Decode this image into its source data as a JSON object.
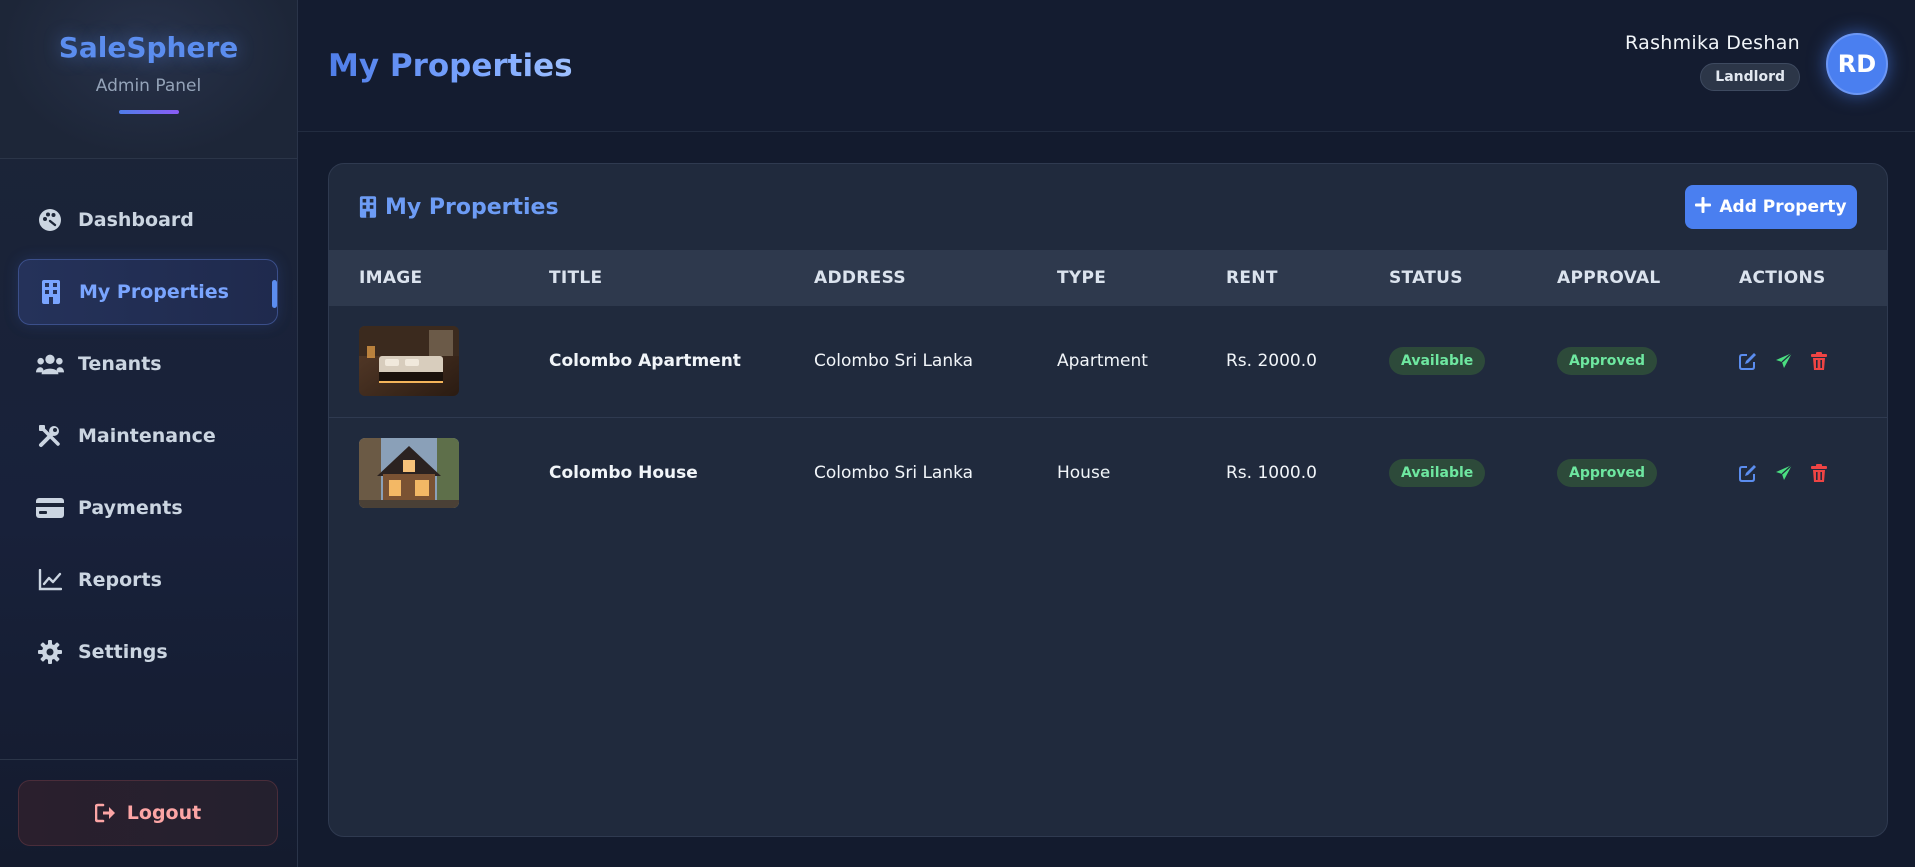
{
  "brand": {
    "name": "SaleSphere",
    "subtitle": "Admin Panel"
  },
  "sidebar": {
    "items": [
      {
        "label": "Dashboard",
        "icon": "palette-icon",
        "active": false
      },
      {
        "label": "My Properties",
        "icon": "building-icon",
        "active": true
      },
      {
        "label": "Tenants",
        "icon": "users-icon",
        "active": false
      },
      {
        "label": "Maintenance",
        "icon": "tools-icon",
        "active": false
      },
      {
        "label": "Payments",
        "icon": "credit-card-icon",
        "active": false
      },
      {
        "label": "Reports",
        "icon": "chart-line-icon",
        "active": false
      },
      {
        "label": "Settings",
        "icon": "gear-icon",
        "active": false
      }
    ],
    "logout_label": "Logout"
  },
  "header": {
    "title": "My Properties",
    "user_name": "Rashmika Deshan",
    "user_role": "Landlord",
    "avatar_initials": "RD"
  },
  "properties_card": {
    "title": "My Properties",
    "add_button_label": "Add Property",
    "columns": [
      "IMAGE",
      "TITLE",
      "ADDRESS",
      "TYPE",
      "RENT",
      "STATUS",
      "APPROVAL",
      "ACTIONS"
    ],
    "rows": [
      {
        "image": "bedroom-photo",
        "title": "Colombo Apartment",
        "address": "Colombo Sri Lanka",
        "type": "Apartment",
        "rent": "Rs. 2000.0",
        "status": "Available",
        "approval": "Approved"
      },
      {
        "image": "house-photo",
        "title": "Colombo House",
        "address": "Colombo Sri Lanka",
        "type": "House",
        "rent": "Rs. 1000.0",
        "status": "Available",
        "approval": "Approved"
      }
    ]
  },
  "colors": {
    "accent": "#4a7ff0",
    "status_green": "#6ee7a0",
    "edit_blue": "#5b8def",
    "send_green": "#4ade80",
    "delete_red": "#ef4444",
    "logout_red": "#fca5a5"
  }
}
